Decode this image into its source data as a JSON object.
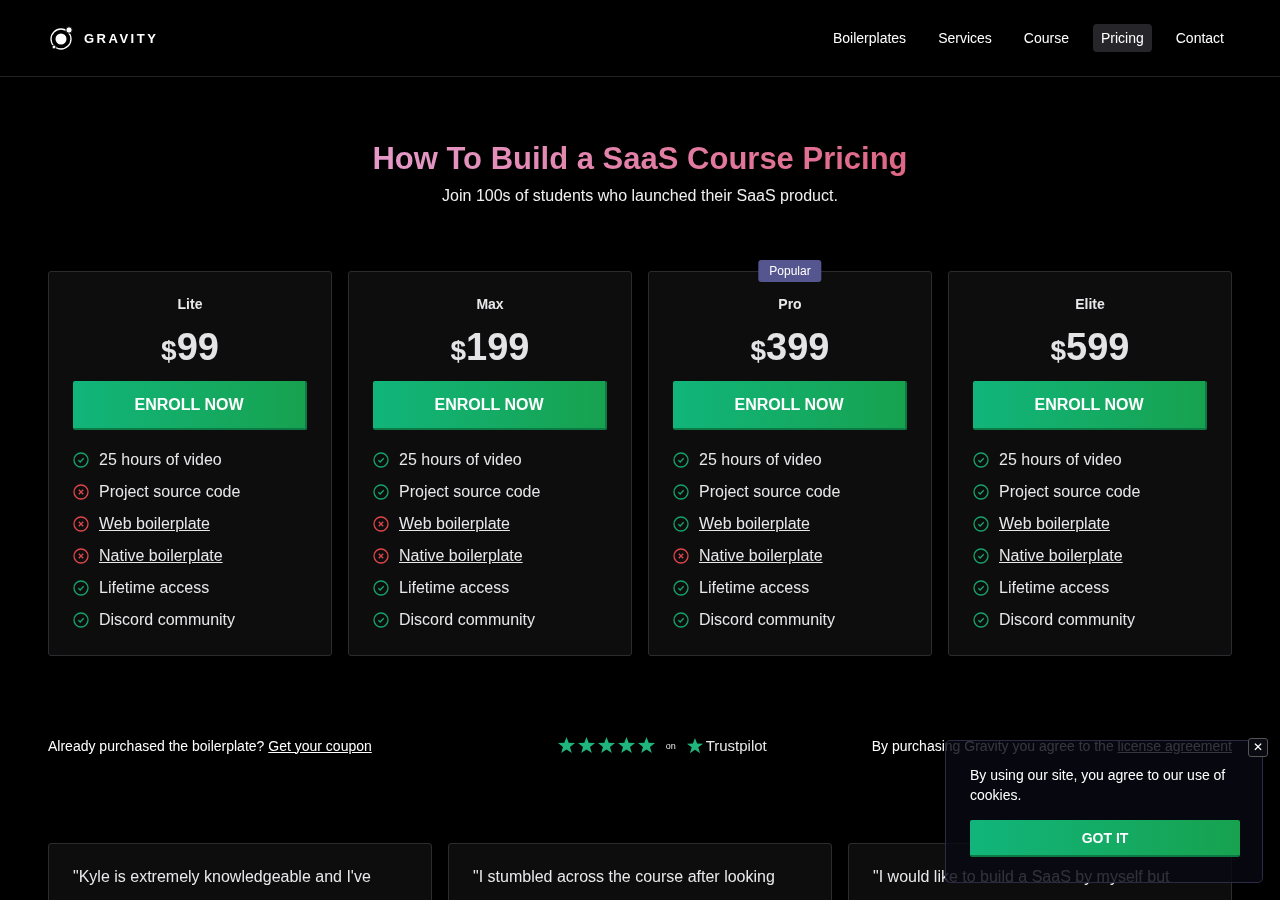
{
  "header": {
    "logo_text": "GRAVITY",
    "nav": [
      {
        "label": "Boilerplates",
        "selected": false
      },
      {
        "label": "Services",
        "selected": false
      },
      {
        "label": "Course",
        "selected": false
      },
      {
        "label": "Pricing",
        "selected": true
      },
      {
        "label": "Contact",
        "selected": false
      }
    ]
  },
  "hero": {
    "title": "How To Build a SaaS Course Pricing",
    "subtitle": "Join 100s of students who launched their SaaS product."
  },
  "plans": [
    {
      "name": "Lite",
      "currency": "$",
      "price": "99",
      "button": "ENROLL NOW",
      "features": [
        {
          "label": "25 hours of video",
          "included": true,
          "kind": "text"
        },
        {
          "label": "Project source code",
          "included": false,
          "kind": "text"
        },
        {
          "label": "Web boilerplate",
          "included": false,
          "kind": "link"
        },
        {
          "label": "Native boilerplate",
          "included": false,
          "kind": "link"
        },
        {
          "label": "Lifetime access",
          "included": true,
          "kind": "text"
        },
        {
          "label": "Discord community",
          "included": true,
          "kind": "text"
        }
      ]
    },
    {
      "name": "Max",
      "currency": "$",
      "price": "199",
      "button": "ENROLL NOW",
      "features": [
        {
          "label": "25 hours of video",
          "included": true,
          "kind": "text"
        },
        {
          "label": "Project source code",
          "included": true,
          "kind": "text"
        },
        {
          "label": "Web boilerplate",
          "included": false,
          "kind": "link"
        },
        {
          "label": "Native boilerplate",
          "included": false,
          "kind": "link"
        },
        {
          "label": "Lifetime access",
          "included": true,
          "kind": "text"
        },
        {
          "label": "Discord community",
          "included": true,
          "kind": "text"
        }
      ]
    },
    {
      "name": "Pro",
      "badge": "Popular",
      "currency": "$",
      "price": "399",
      "button": "ENROLL NOW",
      "features": [
        {
          "label": "25 hours of video",
          "included": true,
          "kind": "text"
        },
        {
          "label": "Project source code",
          "included": true,
          "kind": "text"
        },
        {
          "label": "Web boilerplate",
          "included": true,
          "kind": "link"
        },
        {
          "label": "Native boilerplate",
          "included": false,
          "kind": "link"
        },
        {
          "label": "Lifetime access",
          "included": true,
          "kind": "text"
        },
        {
          "label": "Discord community",
          "included": true,
          "kind": "text"
        }
      ]
    },
    {
      "name": "Elite",
      "currency": "$",
      "price": "599",
      "button": "ENROLL NOW",
      "features": [
        {
          "label": "25 hours of video",
          "included": true,
          "kind": "text"
        },
        {
          "label": "Project source code",
          "included": true,
          "kind": "text"
        },
        {
          "label": "Web boilerplate",
          "included": true,
          "kind": "link"
        },
        {
          "label": "Native boilerplate",
          "included": true,
          "kind": "link"
        },
        {
          "label": "Lifetime access",
          "included": true,
          "kind": "text"
        },
        {
          "label": "Discord community",
          "included": true,
          "kind": "text"
        }
      ]
    }
  ],
  "info_bar": {
    "coupon_text": "Already purchased the boilerplate?",
    "coupon_link": "Get your coupon",
    "rating": {
      "stars": 5,
      "on": "on",
      "brand": "Trustpilot"
    },
    "license_text": "By purchasing Gravity you agree to the",
    "license_link": "license agreement"
  },
  "testimonials": [
    "\"Kyle is extremely knowledgeable and I've",
    "\"I stumbled across the course after looking",
    "\"I would like to build a SaaS by myself but"
  ],
  "cookie_popup": {
    "message": "By using our site, you agree to our use of cookies.",
    "button": "GOT IT",
    "close": "✕"
  }
}
